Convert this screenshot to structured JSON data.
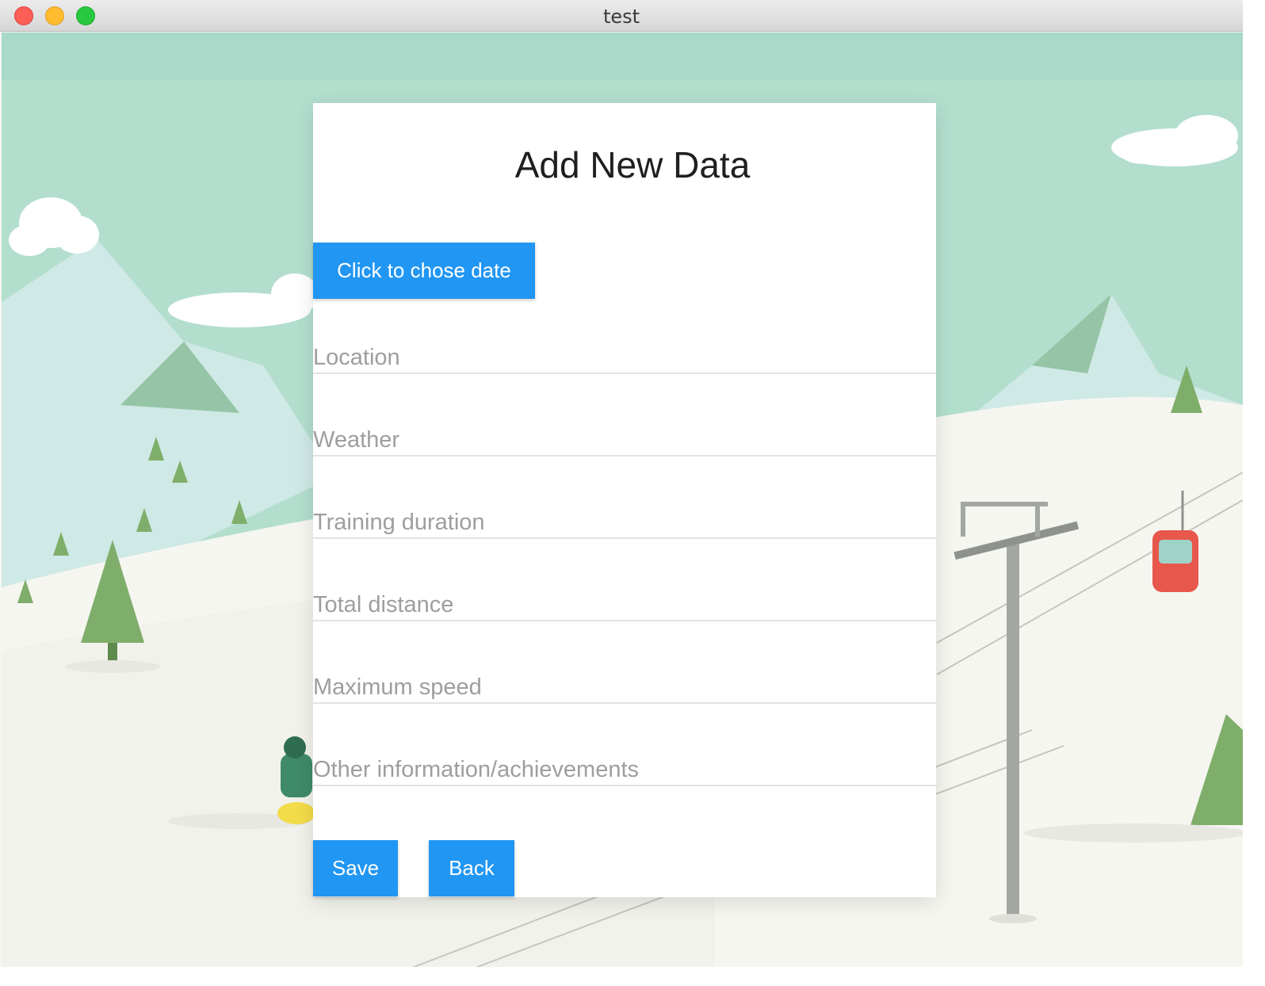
{
  "window": {
    "title": "test"
  },
  "form": {
    "heading": "Add New Data",
    "date_button_label": "Click to chose date",
    "fields": [
      {
        "placeholder": "Location",
        "value": ""
      },
      {
        "placeholder": "Weather",
        "value": ""
      },
      {
        "placeholder": "Training duration",
        "value": ""
      },
      {
        "placeholder": "Total distance",
        "value": ""
      },
      {
        "placeholder": "Maximum speed",
        "value": ""
      },
      {
        "placeholder": "Other information/achievements",
        "value": ""
      }
    ],
    "save_label": "Save",
    "back_label": "Back"
  },
  "colors": {
    "accent": "#2196f3",
    "sky": "#b3dece",
    "snow": "#f6f6f1",
    "gondola": "#e8574b"
  }
}
